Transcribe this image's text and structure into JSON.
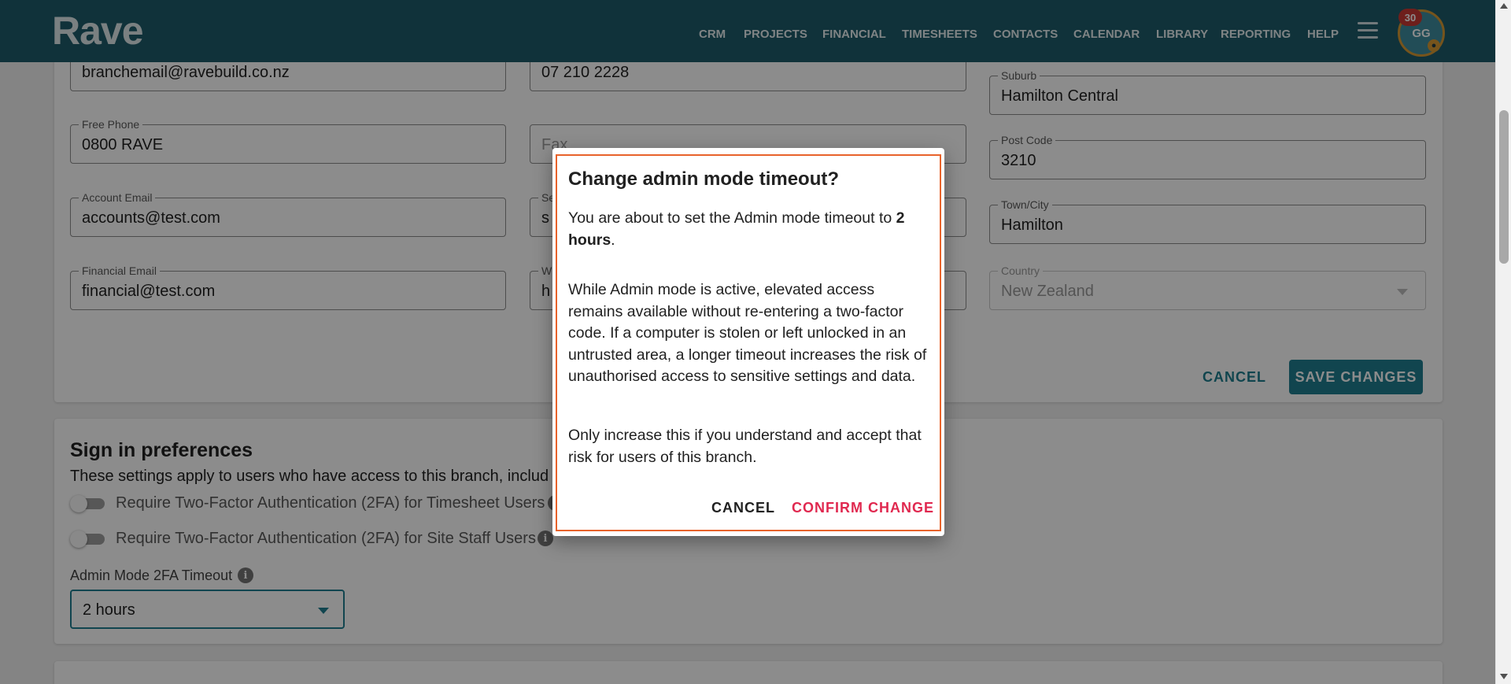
{
  "header": {
    "logo": "Rave",
    "nav": [
      "CRM",
      "PROJECTS",
      "FINANCIAL",
      "TIMESHEETS",
      "CONTACTS",
      "CALENDAR",
      "LIBRARY",
      "REPORTING",
      "HELP"
    ],
    "notification_count": "30",
    "avatar_initials": "GG",
    "brand_color": "#1e5c6b"
  },
  "branch_form": {
    "fields": {
      "email": {
        "value": "branchemail@ravebuild.co.nz"
      },
      "phone": {
        "value": "07 210 2228"
      },
      "suburb": {
        "label": "Suburb",
        "value": "Hamilton Central"
      },
      "free_phone": {
        "label": "Free Phone",
        "value": "0800 RAVE"
      },
      "fax": {
        "placeholder": "Fax"
      },
      "post_code": {
        "label": "Post Code",
        "value": "3210"
      },
      "account_email": {
        "label": "Account Email",
        "value": "accounts@test.com"
      },
      "secondary": {
        "label": "Se",
        "value": "s"
      },
      "town_city": {
        "label": "Town/City",
        "value": "Hamilton"
      },
      "financial_email": {
        "label": "Financial Email",
        "value": "financial@test.com"
      },
      "website": {
        "label": "W",
        "value": "h"
      },
      "country": {
        "label": "Country",
        "value": "New Zealand"
      }
    },
    "cancel_label": "CANCEL",
    "save_label": "SAVE CHANGES"
  },
  "sign_in": {
    "title": "Sign in preferences",
    "description": "These settings apply to users who have access to this branch, includ",
    "toggle_timesheet": "Require Two-Factor Authentication (2FA) for Timesheet Users",
    "toggle_site_staff": "Require Two-Factor Authentication (2FA) for Site Staff Users",
    "timeout_label": "Admin Mode 2FA Timeout",
    "timeout_value": "2 hours"
  },
  "dialog": {
    "title": "Change admin mode timeout?",
    "p1_prefix": "You are about to set the Admin mode timeout to ",
    "p1_bold": "2 hours",
    "p1_suffix": ".",
    "p2": "While Admin mode is active, elevated access remains available without re-entering a two-factor code. If a computer is stolen or left unlocked in an untrusted area, a longer timeout increases the risk of unauthorised access to sensitive settings and data.",
    "p3": "Only increase this if you understand and accept that risk for users of this branch.",
    "cancel_label": "CANCEL",
    "confirm_label": "CONFIRM CHANGE",
    "confirm_color": "#e0284f",
    "border_color": "#e8632b"
  }
}
